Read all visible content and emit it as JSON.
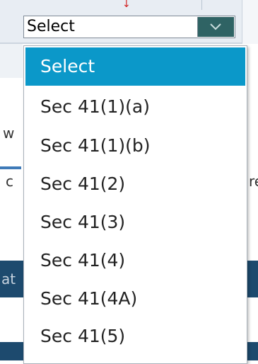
{
  "select": {
    "value": "Select"
  },
  "dropdown": {
    "options": [
      "Select",
      "Sec 41(1)(a)",
      "Sec 41(1)(b)",
      "Sec 41(2)",
      "Sec 41(3)",
      "Sec 41(4)",
      "Sec 41(4A)",
      "Sec 41(5)"
    ],
    "highlighted_index": 0
  },
  "background": {
    "fragment_w": "w",
    "fragment_c": "c",
    "fragment_re": "re",
    "fragment_at": "at",
    "arrow": "↓"
  },
  "colors": {
    "highlight": "#0b98c9",
    "button": "#2f6364",
    "page_bar": "#1d4a6e"
  },
  "icons": {
    "dropdown_button": "chevron-down-icon"
  }
}
